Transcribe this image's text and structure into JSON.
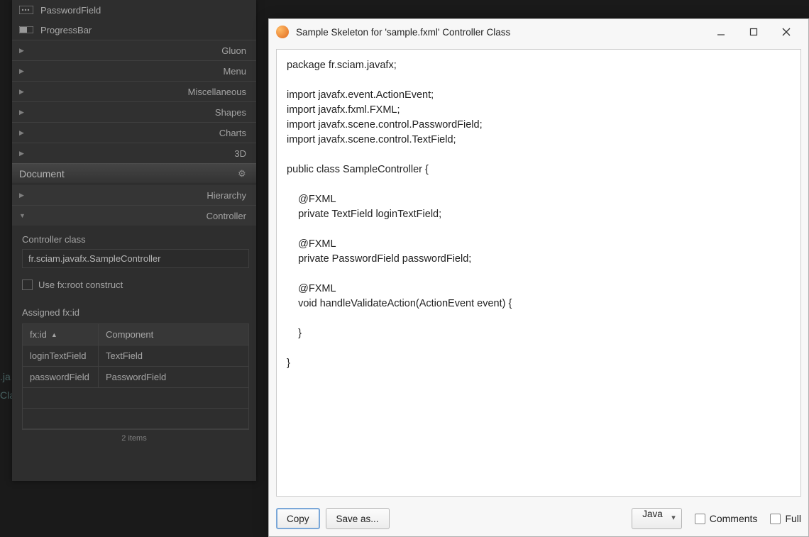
{
  "library": {
    "items": [
      {
        "name": "PasswordField",
        "icon": "pwd"
      },
      {
        "name": "ProgressBar",
        "icon": "prog"
      }
    ],
    "categories": [
      "Gluon",
      "Menu",
      "Miscellaneous",
      "Shapes",
      "Charts",
      "3D"
    ]
  },
  "document": {
    "header": "Document",
    "sections": [
      "Hierarchy",
      "Controller"
    ]
  },
  "controller": {
    "class_label": "Controller class",
    "class_value": "fr.sciam.javafx.SampleController",
    "fxroot_label": "Use fx:root construct",
    "assigned_label": "Assigned fx:id",
    "table": {
      "columns": [
        "fx:id",
        "Component"
      ],
      "rows": [
        {
          "id": "loginTextField",
          "component": "TextField"
        },
        {
          "id": "passwordField",
          "component": "PasswordField"
        }
      ],
      "footer": "2 items"
    }
  },
  "bg_lines": [
    ".ja",
    "Cla"
  ],
  "dialog": {
    "title": "Sample Skeleton for 'sample.fxml' Controller Class",
    "code": "package fr.sciam.javafx;\n\nimport javafx.event.ActionEvent;\nimport javafx.fxml.FXML;\nimport javafx.scene.control.PasswordField;\nimport javafx.scene.control.TextField;\n\npublic class SampleController {\n\n    @FXML\n    private TextField loginTextField;\n\n    @FXML\n    private PasswordField passwordField;\n\n    @FXML\n    void handleValidateAction(ActionEvent event) {\n\n    }\n\n}",
    "buttons": {
      "copy": "Copy",
      "save": "Save as..."
    },
    "lang": "Java",
    "check_comments": "Comments",
    "check_full": "Full"
  }
}
